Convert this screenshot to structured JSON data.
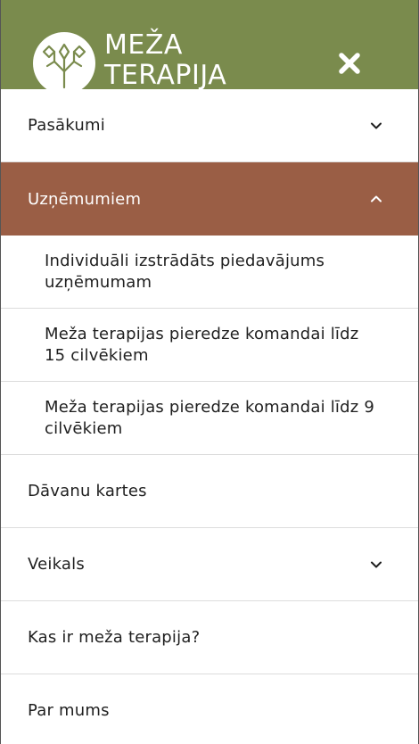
{
  "header": {
    "brand_line1": "MEŽA",
    "brand_line2": "TERAPIJA",
    "logo_icon": "tree-branch-logo",
    "close_icon": "close-icon",
    "background_color": "#7a8b4d"
  },
  "menu": {
    "active_color": "#9a5e45",
    "items": [
      {
        "label": "Pasākumi",
        "has_submenu": true,
        "expanded": false
      },
      {
        "label": "Uzņēmumiem",
        "has_submenu": true,
        "expanded": true,
        "subitems": [
          {
            "label": "Individuāli izstrādāts piedavājums uzņēmumam"
          },
          {
            "label": "Meža terapijas pieredze komandai līdz 15 cilvēkiem"
          },
          {
            "label": "Meža terapijas pieredze komandai līdz 9 cilvēkiem"
          }
        ]
      },
      {
        "label": "Dāvanu kartes",
        "has_submenu": false
      },
      {
        "label": "Veikals",
        "has_submenu": true,
        "expanded": false
      },
      {
        "label": "Kas ir meža terapija?",
        "has_submenu": false
      },
      {
        "label": "Par mums",
        "has_submenu": false
      }
    ]
  }
}
